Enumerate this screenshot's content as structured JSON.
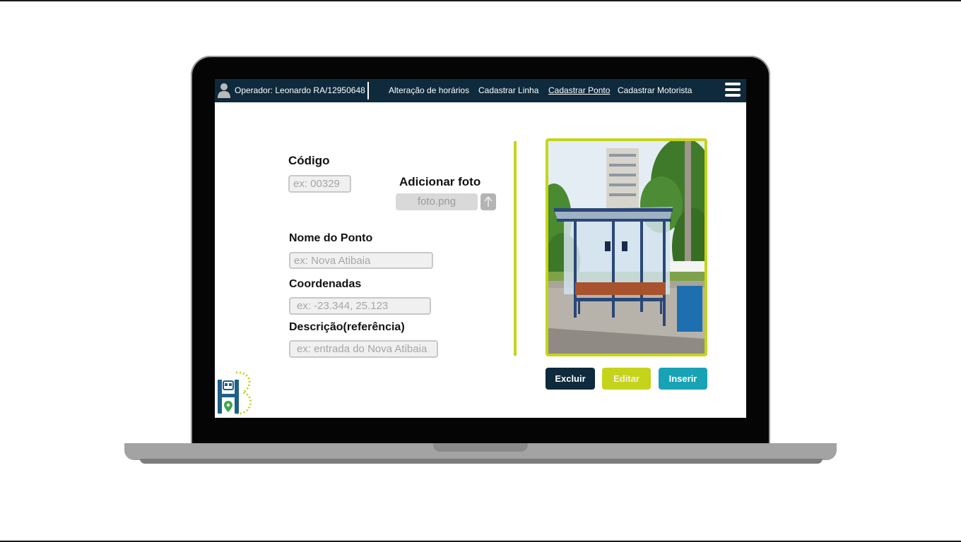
{
  "navbar": {
    "operator": "Operador: Leonardo RA/12950648",
    "links": [
      "Alteração de horários",
      "Cadastrar Linha",
      "Cadastrar Ponto",
      "Cadastrar Motorista"
    ],
    "active_link": "Cadastrar Ponto"
  },
  "form": {
    "codigo_label": "Código",
    "codigo_placeholder": "ex: 00329",
    "foto_label": "Adicionar foto",
    "foto_file": "foto.png",
    "nome_label": "Nome do  Ponto",
    "nome_placeholder": "ex: Nova Atibaia",
    "coord_label": "Coordenadas",
    "coord_placeholder": "ex: -23.344, 25.123",
    "descricao_label": "Descrição(referência)",
    "descricao_placeholder": "ex: entrada do Nova Atibaia"
  },
  "actions": {
    "excluir": "Excluir",
    "editar": "Editar",
    "inserir": "Inserir"
  },
  "colors": {
    "navbar": "#0e2a3c",
    "accent_lime": "#c5d41a",
    "accent_teal": "#17a3b5"
  },
  "icons": [
    "user-icon",
    "hamburger-menu-icon",
    "upload-arrow-icon",
    "app-logo-icon"
  ]
}
